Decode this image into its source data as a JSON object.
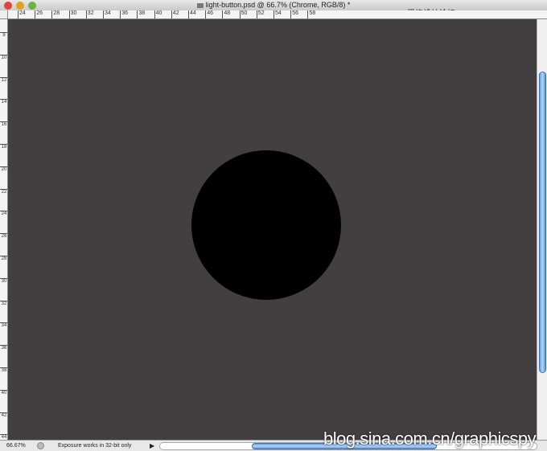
{
  "window": {
    "title": "light-button.psd @ 66.7% (Chrome, RGB/8) *"
  },
  "ruler_top": {
    "labels": [
      "24",
      "26",
      "28",
      "30",
      "32",
      "34",
      "36",
      "38",
      "40",
      "42",
      "44",
      "46",
      "48",
      "50",
      "52",
      "54",
      "56",
      "58"
    ]
  },
  "ruler_left": {
    "labels": [
      "8",
      "10",
      "12",
      "14",
      "16",
      "18",
      "20",
      "22",
      "24",
      "26",
      "28",
      "30",
      "32",
      "34",
      "36",
      "38",
      "40",
      "42",
      "44"
    ]
  },
  "canvas": {
    "background": "#433e40",
    "shape_color": "#000000"
  },
  "status": {
    "zoom": "66.67%",
    "message": "Exposure works in 32-bit only"
  },
  "watermarks": {
    "top": "思缘设计论坛 www.MISSYUAN.COM",
    "bottom": "blog.sina.com.cn/graphicspy"
  }
}
